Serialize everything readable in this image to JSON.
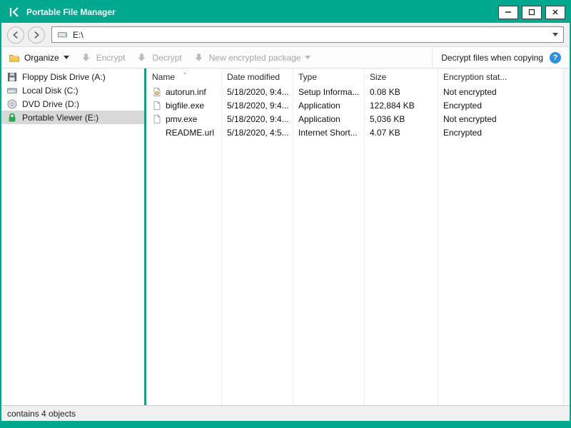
{
  "window": {
    "title": "Portable File Manager"
  },
  "navbar": {
    "address": "E:\\"
  },
  "toolbar": {
    "organize_label": "Organize",
    "encrypt_label": "Encrypt",
    "decrypt_label": "Decrypt",
    "new_package_label": "New encrypted package",
    "decrypt_when_copying_label": "Decrypt files when copying"
  },
  "sidebar": {
    "items": [
      {
        "label": "Floppy Disk Drive (A:)",
        "icon": "floppy-drive-icon",
        "selected": false
      },
      {
        "label": "Local Disk (C:)",
        "icon": "local-disk-icon",
        "selected": false
      },
      {
        "label": "DVD Drive (D:)",
        "icon": "dvd-drive-icon",
        "selected": false
      },
      {
        "label": "Portable Viewer (E:)",
        "icon": "lock-icon",
        "selected": true
      }
    ]
  },
  "filelist": {
    "columns": [
      {
        "label": "Name",
        "sorted": true
      },
      {
        "label": "Date modified",
        "sorted": false
      },
      {
        "label": "Type",
        "sorted": false
      },
      {
        "label": "Size",
        "sorted": false
      },
      {
        "label": "Encryption stat...",
        "sorted": false
      }
    ],
    "rows": [
      {
        "icon": "setup-information-file-icon",
        "name": "autorun.inf",
        "date_modified": "5/18/2020, 9:4...",
        "type": "Setup Informa...",
        "size": "0.08 KB",
        "encryption_status": "Not encrypted"
      },
      {
        "icon": "file-icon",
        "name": "bigfile.exe",
        "date_modified": "5/18/2020, 9:4...",
        "type": "Application",
        "size": "122,884 KB",
        "encryption_status": "Encrypted"
      },
      {
        "icon": "file-icon",
        "name": "pmv.exe",
        "date_modified": "5/18/2020, 9:4...",
        "type": "Application",
        "size": "5,036 KB",
        "encryption_status": "Not encrypted"
      },
      {
        "icon": "",
        "name": "README.url",
        "date_modified": "5/18/2020, 4:5...",
        "type": "Internet Short...",
        "size": "4.07 KB",
        "encryption_status": "Encrypted"
      }
    ]
  },
  "statusbar": {
    "text": "contains 4 objects"
  },
  "icons": {
    "sort_caret": "ˆ",
    "help_glyph": "?"
  },
  "colors": {
    "brand_teal": "#00a88e",
    "selected_item_bg": "#d8d8d8",
    "help_icon_blue": "#2d8fe2",
    "disabled_text": "#a6a6a6"
  }
}
